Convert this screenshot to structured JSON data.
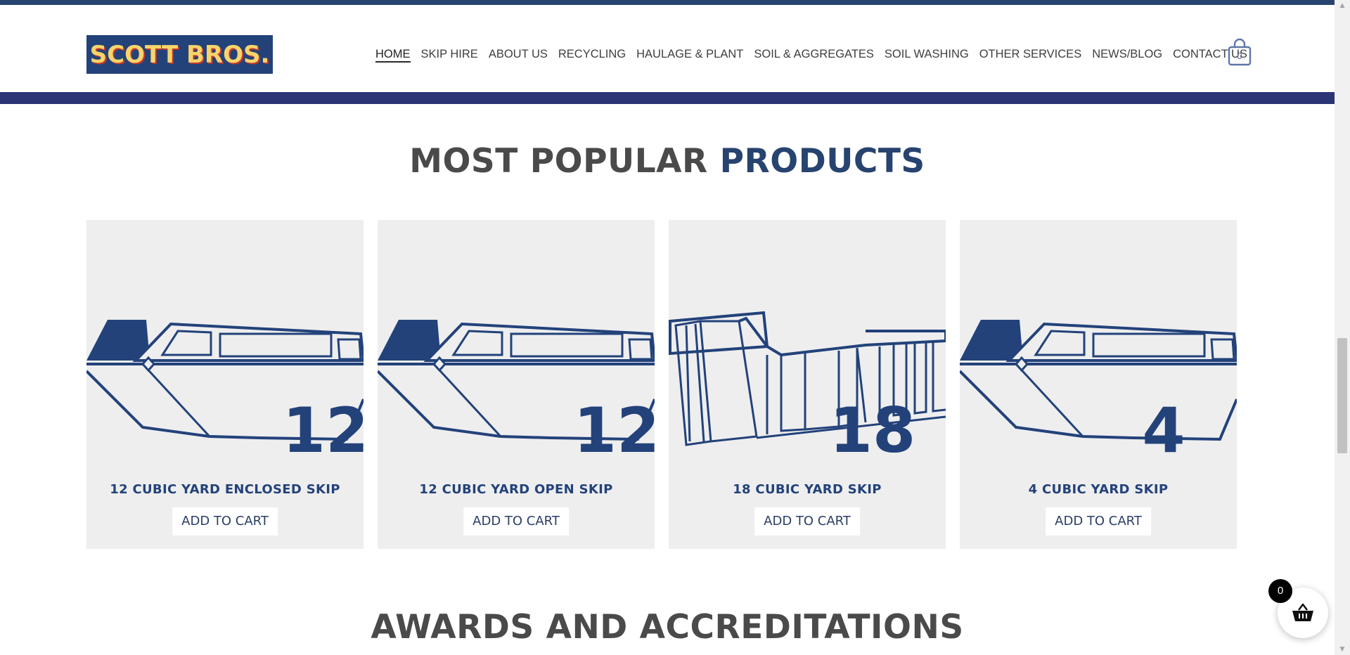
{
  "header": {
    "logo_text": "SCOTT BROS.",
    "nav": [
      {
        "label": "HOME",
        "active": true
      },
      {
        "label": "SKIP HIRE",
        "active": false
      },
      {
        "label": "ABOUT US",
        "active": false
      },
      {
        "label": "RECYCLING",
        "active": false
      },
      {
        "label": "HAULAGE & PLANT",
        "active": false
      },
      {
        "label": "SOIL & AGGREGATES",
        "active": false
      },
      {
        "label": "SOIL WASHING",
        "active": false
      },
      {
        "label": "OTHER SERVICES",
        "active": false
      },
      {
        "label": "NEWS/BLOG",
        "active": false
      },
      {
        "label": "CONTACT US",
        "active": false
      }
    ],
    "cart_count": "0"
  },
  "popular": {
    "title_part1": "MOST POPULAR",
    "title_part2": "PRODUCTS",
    "products": [
      {
        "name": "12 CUBIC YARD ENCLOSED SKIP",
        "size": "12",
        "image": "enclosed-skip",
        "button": "ADD TO CART"
      },
      {
        "name": "12 CUBIC YARD OPEN SKIP",
        "size": "12",
        "image": "open-skip",
        "button": "ADD TO CART"
      },
      {
        "name": "18 CUBIC YARD SKIP",
        "size": "18",
        "image": "roro-skip",
        "button": "ADD TO CART"
      },
      {
        "name": "4 CUBIC YARD SKIP",
        "size": "4",
        "image": "open-skip",
        "button": "ADD TO CART"
      }
    ]
  },
  "awards": {
    "title": "AWARDS AND ACCREDITATIONS"
  },
  "floating_cart": {
    "count": "0",
    "icon": "basket-icon"
  },
  "colors": {
    "brand_navy": "#23427a",
    "header_band": "#2b3575",
    "card_bg": "#eeeeef",
    "logo_yellow": "#f7d46a"
  }
}
